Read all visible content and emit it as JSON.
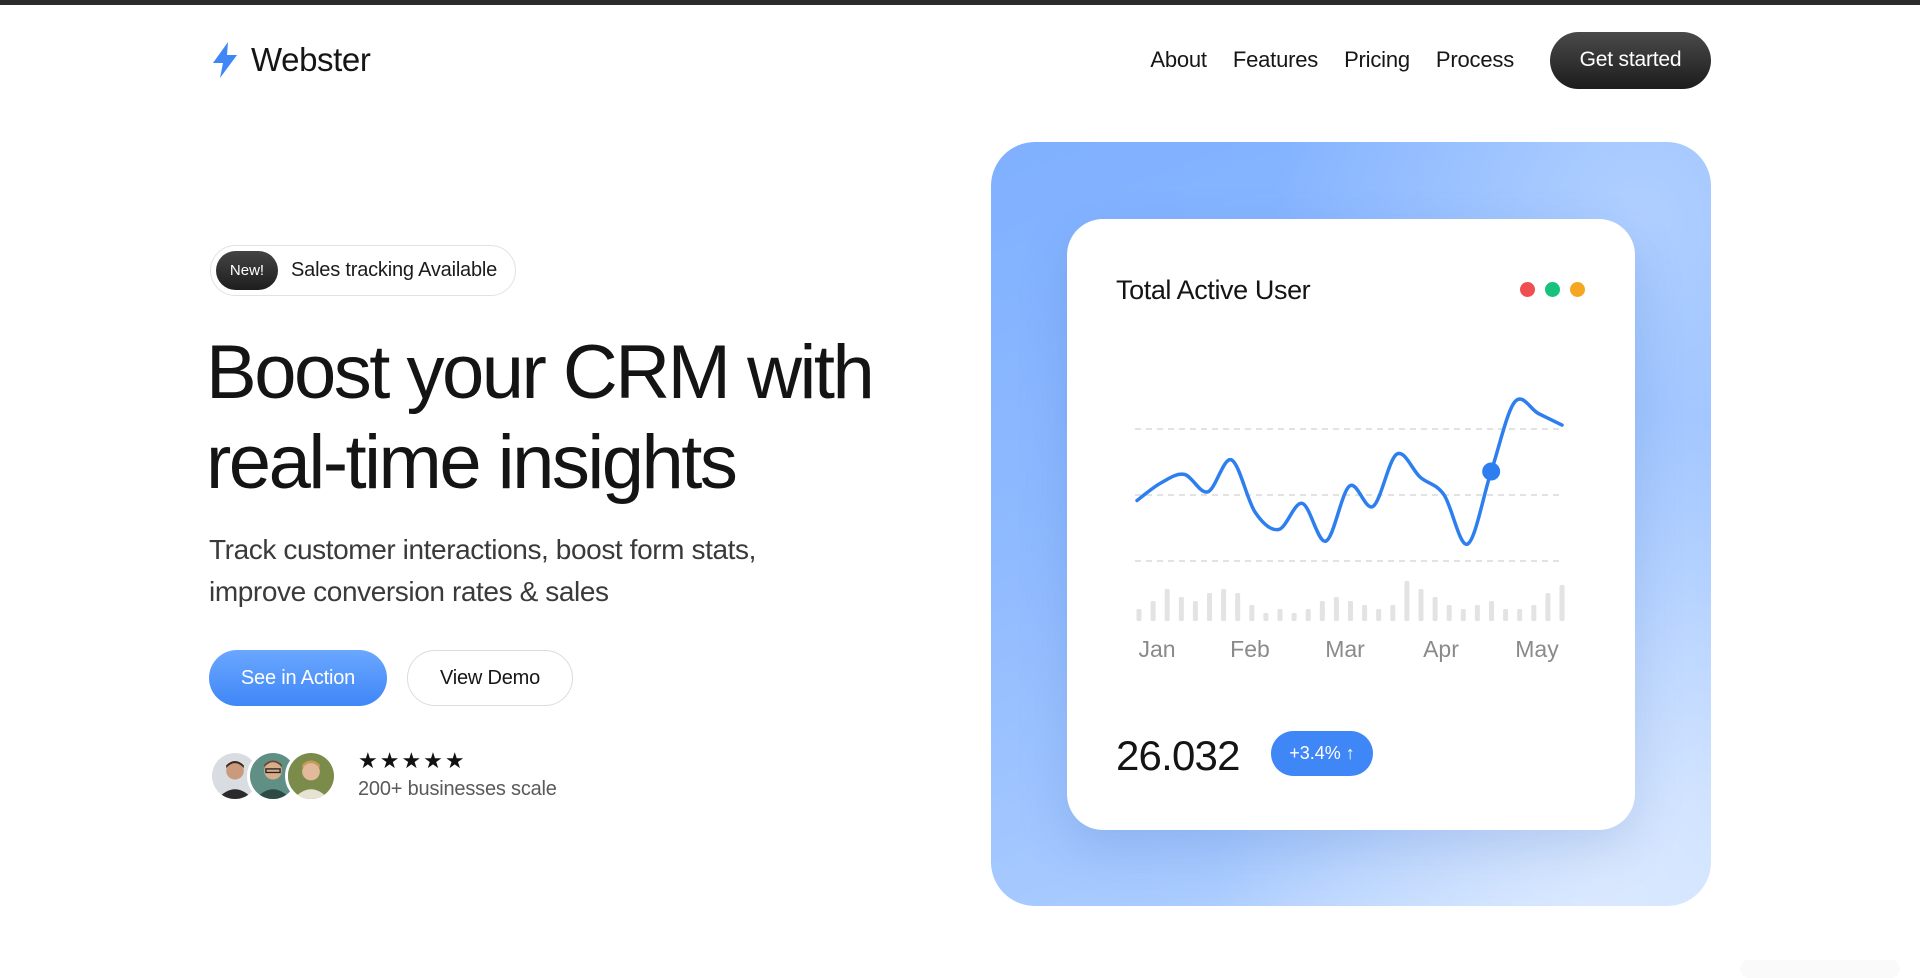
{
  "brand": {
    "name": "Webster",
    "accent": "#3f86f7"
  },
  "nav": {
    "links": [
      "About",
      "Features",
      "Pricing",
      "Process"
    ],
    "cta": "Get started"
  },
  "hero": {
    "badge_tag": "New!",
    "badge_text": "Sales tracking Available",
    "headline_line1": "Boost your CRM with",
    "headline_line2": "real-time insights",
    "subtext_line1": "Track customer interactions, boost form stats,",
    "subtext_line2": "improve conversion rates & sales",
    "primary_button": "See in Action",
    "secondary_button": "View Demo",
    "rating_stars": "★★★★★",
    "rating": 5,
    "social_proof": "200+ businesses scale"
  },
  "card": {
    "title": "Total Active User",
    "window_dots": [
      "#f04f4f",
      "#17c27a",
      "#f5a623"
    ],
    "value": "26.032",
    "delta": "+3.4% ↑"
  },
  "chart_data": {
    "type": "line",
    "categories": [
      "Jan",
      "Feb",
      "Mar",
      "Apr",
      "May"
    ],
    "series": [
      {
        "values": [
          30,
          42,
          48,
          36,
          58,
          22,
          10,
          28,
          2,
          40,
          26,
          62,
          46,
          34,
          0,
          50,
          98,
          90,
          82
        ]
      }
    ],
    "highlight_index": 15,
    "gridlines": 3,
    "volume_bars": [
      3,
      5,
      8,
      6,
      5,
      7,
      8,
      7,
      4,
      2,
      3,
      2,
      3,
      5,
      6,
      5,
      4,
      3,
      4,
      10,
      8,
      6,
      4,
      3,
      4,
      5,
      3,
      3,
      4,
      7,
      9
    ],
    "line_color": "#2d7ff0"
  }
}
